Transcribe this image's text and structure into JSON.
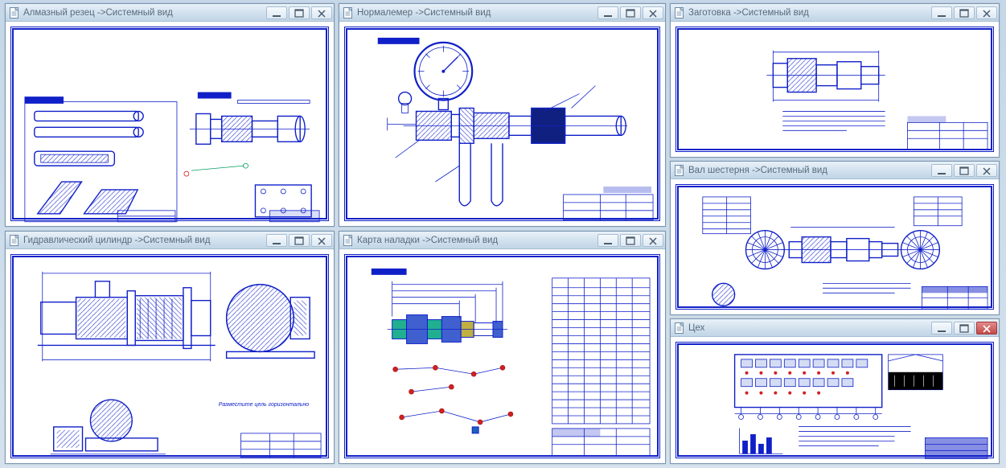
{
  "windows": {
    "w1": {
      "title": "Алмазный резец ->Системный вид"
    },
    "w2": {
      "title": "Нормалемер ->Системный вид"
    },
    "w3": {
      "title": "Заготовка ->Системный вид"
    },
    "w4": {
      "title": "Гидравлический цилиндр ->Системный вид"
    },
    "w5": {
      "title": "Карта наладки ->Системный вид"
    },
    "w6": {
      "title": "Вал шестерня ->Системный вид"
    },
    "w7": {
      "title": "Цех"
    }
  },
  "captions": {
    "w4_note": "Разместите цель горизонтально"
  }
}
